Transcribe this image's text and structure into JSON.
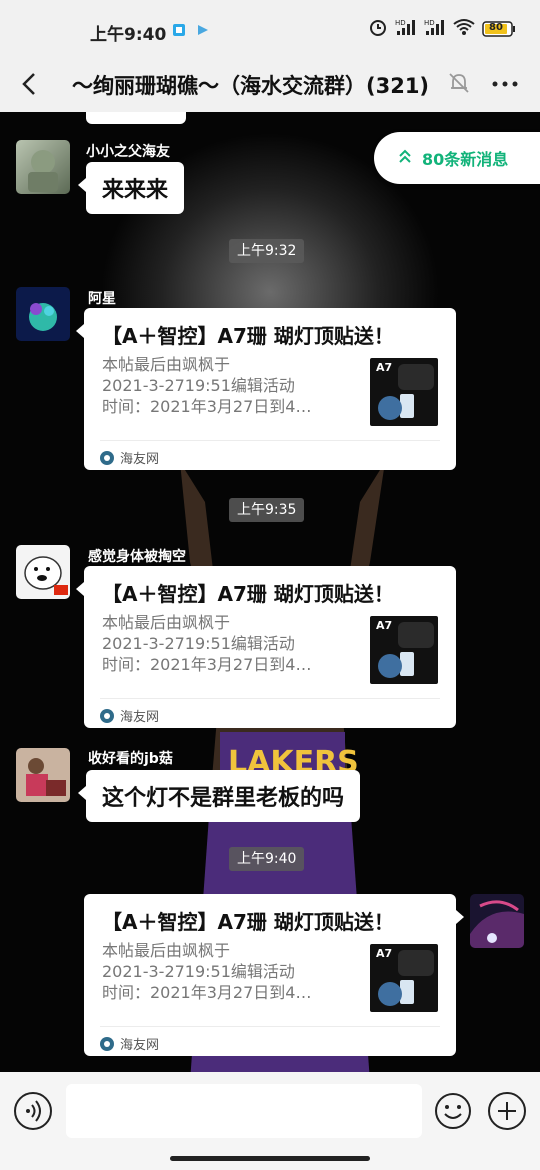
{
  "status_bar": {
    "time": "上午9:40",
    "battery": "80",
    "icons": [
      "app-notification-icon",
      "app-notification-icon-2",
      "alarm-icon",
      "signal-hd-icon",
      "signal-hd-icon-2",
      "wifi-icon",
      "battery-icon"
    ]
  },
  "header": {
    "title": "〜绚丽珊瑚礁〜（海水交流群）(321)",
    "icons": [
      "back-arrow-icon",
      "mute-bell-icon",
      "more-icon"
    ]
  },
  "new_messages": {
    "label": "80条新消息",
    "icon": "double-chevron-up-icon",
    "color": "#12b37a"
  },
  "messages": [
    {
      "type": "text",
      "sender": "小小之父海友",
      "text": "来来来"
    },
    {
      "type": "time",
      "text": "上午9:32"
    },
    {
      "type": "card",
      "sender": "阿星",
      "title": "【A＋智控】A7珊 瑚灯顶贴送！",
      "desc_lines": [
        "本帖最后由飒枫于",
        "2021-3-2719:51编辑活动",
        "时间：2021年3月27日到4…"
      ],
      "thumb_label": "A7",
      "source": "海友网"
    },
    {
      "type": "time",
      "text": "上午9:35"
    },
    {
      "type": "card",
      "sender": "感觉身体被掏空",
      "title": "【A＋智控】A7珊 瑚灯顶贴送！",
      "desc_lines": [
        "本帖最后由飒枫于",
        "2021-3-2719:51编辑活动",
        "时间：2021年3月27日到4…"
      ],
      "thumb_label": "A7",
      "source": "海友网"
    },
    {
      "type": "text",
      "sender": "收好看的jb菇",
      "text": "这个灯不是群里老板的吗"
    },
    {
      "type": "time",
      "text": "上午9:40"
    },
    {
      "type": "card",
      "sender": "",
      "title": "【A＋智控】A7珊 瑚灯顶贴送！",
      "desc_lines": [
        "本帖最后由飒枫于",
        "2021-3-2719:51编辑活动",
        "时间：2021年3月27日到4…"
      ],
      "thumb_label": "A7",
      "source": "海友网"
    }
  ],
  "input_bar": {
    "value": "",
    "icons": [
      "voice-icon",
      "emoji-icon",
      "plus-icon"
    ]
  },
  "colors": {
    "accent": "#12b37a",
    "bubble": "#ffffff",
    "time_chip": "#5a5a5a"
  }
}
